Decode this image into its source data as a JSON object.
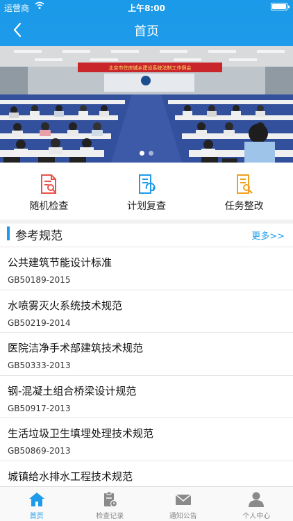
{
  "status_bar": {
    "carrier": "运营商",
    "time": "上午8:00"
  },
  "nav": {
    "title": "首页"
  },
  "banner": {
    "sign_text": "北京市住房城乡建设系统法制工作例会",
    "slide_count": 2,
    "active_slide": 1
  },
  "actions": [
    {
      "label": "随机检查",
      "icon": "random-check-icon",
      "color": "#e8524a"
    },
    {
      "label": "计划复查",
      "icon": "plan-review-icon",
      "color": "#1e9bea"
    },
    {
      "label": "任务整改",
      "icon": "task-rectify-icon",
      "color": "#f0a020"
    }
  ],
  "section": {
    "title": "参考规范",
    "more": "更多>>"
  },
  "standards": [
    {
      "name": "公共建筑节能设计标准",
      "code": "GB50189-2015"
    },
    {
      "name": "水喷雾灭火系统技术规范",
      "code": "GB50219-2014"
    },
    {
      "name": "医院洁净手术部建筑技术规范",
      "code": "GB50333-2013"
    },
    {
      "name": "钢-混凝土组合桥梁设计规范",
      "code": "GB50917-2013"
    },
    {
      "name": "生活垃圾卫生填埋处理技术规范",
      "code": "GB50869-2013"
    },
    {
      "name": "城镇给水排水工程技术规范",
      "code": ""
    }
  ],
  "tabbar": [
    {
      "label": "首页",
      "icon": "home-icon",
      "active": true
    },
    {
      "label": "检查记录",
      "icon": "clipboard-icon",
      "active": false
    },
    {
      "label": "通知公告",
      "icon": "mail-icon",
      "active": false
    },
    {
      "label": "个人中心",
      "icon": "person-icon",
      "active": false
    }
  ],
  "colors": {
    "primary": "#1e9bea",
    "inactive": "#888888",
    "divider": "#e6e6e6"
  }
}
